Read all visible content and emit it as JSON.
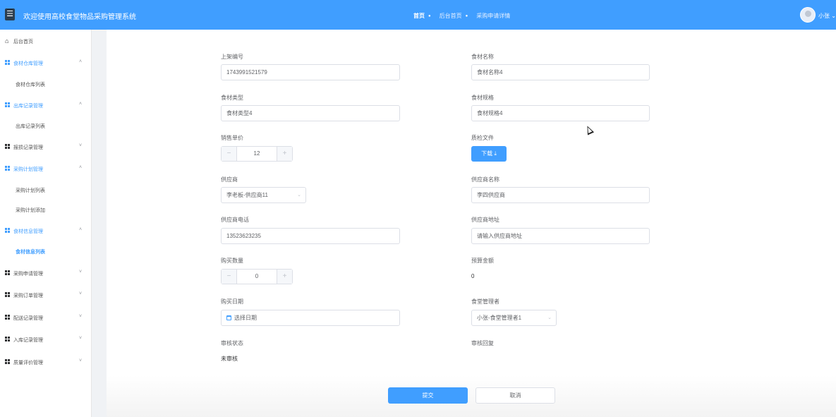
{
  "header": {
    "menu_icon": "☰",
    "title": "欢迎使用高校食堂物品采购管理系统",
    "breadcrumb": [
      "首页",
      "后台首页",
      "采购申请详情"
    ],
    "user": "小张"
  },
  "sidebar": {
    "home": "后台首页",
    "groups": [
      {
        "label": "食材仓库管理",
        "expanded": true,
        "children": [
          "食材仓库列表"
        ]
      },
      {
        "label": "出库记录管理",
        "expanded": true,
        "children": [
          "出库记录列表"
        ]
      },
      {
        "label": "报损记录管理",
        "expanded": false,
        "children": []
      },
      {
        "label": "采购计划管理",
        "expanded": true,
        "children": [
          "采购计划列表",
          "采购计划添加"
        ]
      },
      {
        "label": "食材信息管理",
        "expanded": true,
        "children": [
          "食材信息列表"
        ]
      },
      {
        "label": "采购申请管理",
        "expanded": false,
        "children": []
      },
      {
        "label": "采购订单管理",
        "expanded": false,
        "children": []
      },
      {
        "label": "配送记录管理",
        "expanded": false,
        "children": []
      },
      {
        "label": "入库记录管理",
        "expanded": false,
        "children": []
      },
      {
        "label": "质量评价管理",
        "expanded": false,
        "children": []
      }
    ]
  },
  "form": {
    "listing_no": {
      "label": "上架编号",
      "value": "1743991521579"
    },
    "food_name": {
      "label": "食材名称",
      "value": "食材名称4"
    },
    "food_type": {
      "label": "食材类型",
      "value": "食材类型4"
    },
    "food_spec": {
      "label": "食材规格",
      "value": "食材规格4"
    },
    "unit_price": {
      "label": "销售单价",
      "value": "12"
    },
    "qc_file": {
      "label": "质检文件",
      "button": "下载 ⤓"
    },
    "supplier": {
      "label": "供应商",
      "value": "李老板-供应商11"
    },
    "supplier_name": {
      "label": "供应商名称",
      "value": "李四供应商"
    },
    "supplier_phone": {
      "label": "供应商电话",
      "value": "13523623235"
    },
    "supplier_address": {
      "label": "供应商地址",
      "placeholder": "请输入供应商地址"
    },
    "quantity": {
      "label": "购买数量",
      "value": "0"
    },
    "budget": {
      "label": "预算金额",
      "value": "0"
    },
    "purchase_date": {
      "label": "购买日期",
      "placeholder": "选择日期"
    },
    "canteen_manager": {
      "label": "食堂管理者",
      "value": "小张-食堂管理者1"
    },
    "review_status": {
      "label": "审核状态",
      "value": "未审核"
    },
    "review_reply": {
      "label": "审核回复"
    }
  },
  "actions": {
    "submit": "提交",
    "cancel": "取消"
  },
  "colors": {
    "primary": "#409eff",
    "dark": "#2c3e50"
  }
}
